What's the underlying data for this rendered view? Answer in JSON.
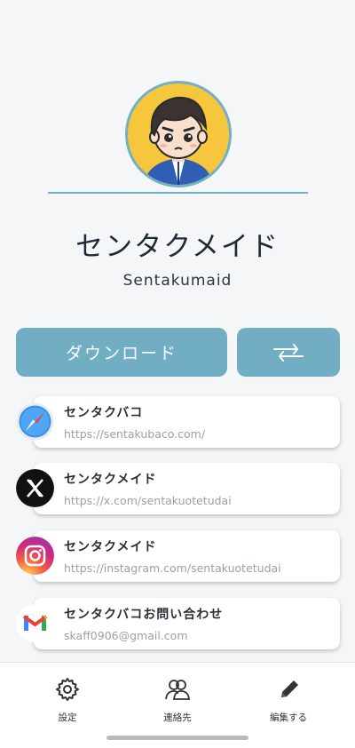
{
  "profile": {
    "display_name": "センタクメイド",
    "sub_name": "Sentakumaid"
  },
  "actions": {
    "download_label": "ダウンロード",
    "swap_icon": "swap-arrows-icon"
  },
  "links": [
    {
      "title": "センタクバコ",
      "url": "https://sentakubaco.com/",
      "icon": "safari-compass-icon"
    },
    {
      "title": "センタクメイド",
      "url": "https://x.com/sentakuotetudai",
      "icon": "x-logo-icon"
    },
    {
      "title": "センタクメイド",
      "url": "https://instagram.com/sentakuotetudai",
      "icon": "instagram-logo-icon"
    },
    {
      "title": "センタクバコお問い合わせ",
      "url": "skaff0906@gmail.com",
      "icon": "gmail-logo-icon"
    }
  ],
  "nav": {
    "settings": "設定",
    "contacts": "連絡先",
    "edit": "編集する"
  },
  "colors": {
    "accent": "#72aec3",
    "avatar_bg": "#f6c73c"
  }
}
